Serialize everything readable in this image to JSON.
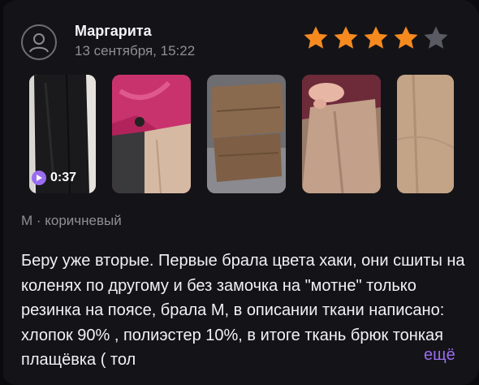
{
  "review": {
    "author": "Маргарита",
    "date": "13 сентября, 15:22",
    "rating": 4,
    "rating_max": 5,
    "media": [
      {
        "type": "video",
        "duration": "0:37",
        "subject": "black trousers"
      },
      {
        "type": "photo",
        "subject": "pink satin fabric and trousers"
      },
      {
        "type": "photo",
        "subject": "brown trousers folded"
      },
      {
        "type": "photo",
        "subject": "beige trousers held by hand"
      },
      {
        "type": "photo",
        "subject": "beige trousers partial"
      }
    ],
    "variant": "M · коричневый",
    "text": "Беру уже вторые. Первые брала цвета хаки, они сшиты на коленях по другому и без замочка на \"мотне\" только резинка на поясе, брала М, в описании ткани написано: хлопок 90% , полиэстер 10%, в итоге ткань брюк тонкая плащёвка ( тол",
    "more_label": "ещё"
  },
  "colors": {
    "star_filled": "#f68a1f",
    "star_empty": "#5a5a62",
    "accent": "#9a6cf0",
    "background": "#141418",
    "muted_text": "#8e8e96"
  },
  "icons": {
    "avatar": "user-circle-icon",
    "play": "play-icon",
    "star": "star-icon"
  }
}
